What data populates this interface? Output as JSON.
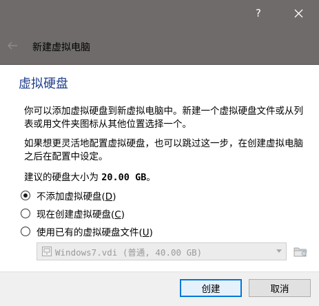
{
  "window": {
    "help_glyph": "?",
    "close_icon": "close-icon"
  },
  "wizard": {
    "title": "新建虚拟电脑",
    "back_icon": "back-arrow-icon"
  },
  "page": {
    "title": "虚拟硬盘",
    "paragraph1": "你可以添加虚拟硬盘到新虚拟电脑中。新建一个虚拟硬盘文件或从列表或用文件夹图标从其他位置选择一个。",
    "paragraph2": "如果想更灵活地配置虚拟硬盘，也可以跳过这一步，在创建虚拟电脑之后在配置中设定。",
    "suggest_prefix": "建议的硬盘大小为 ",
    "suggest_size": "20.00 GB",
    "suggest_suffix": "。"
  },
  "options": [
    {
      "label": "不添加虚拟硬盘(",
      "key": "D",
      "close": ")",
      "checked": true
    },
    {
      "label": "现在创建虚拟硬盘(",
      "key": "C",
      "close": ")",
      "checked": false
    },
    {
      "label": "使用已有的虚拟硬盘文件(",
      "key": "U",
      "close": ")",
      "checked": false
    }
  ],
  "disk_select": {
    "value": "Windows7.vdi (普通, 40.00 GB)",
    "enabled": false
  },
  "buttons": {
    "create": "创建",
    "cancel": "取消"
  },
  "colors": {
    "titlebar": "#6f6b6b",
    "heading": "#1f3f8c",
    "default_button_border": "#0078d7"
  }
}
